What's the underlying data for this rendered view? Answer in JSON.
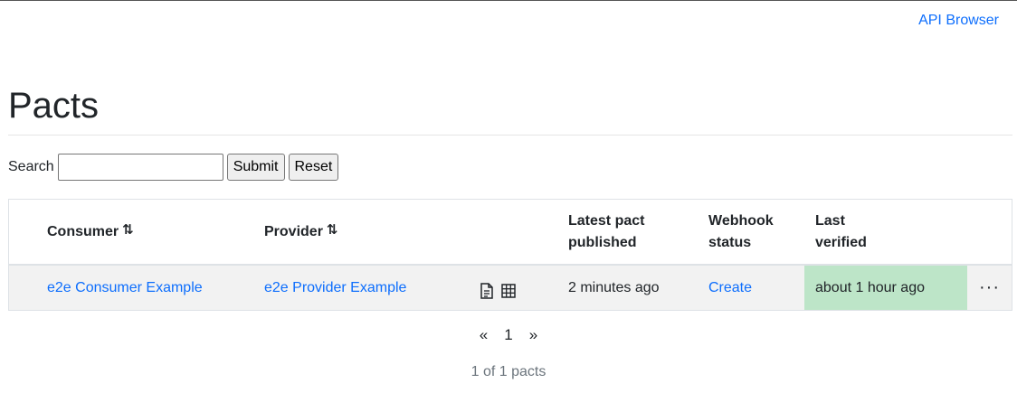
{
  "nav": {
    "api_browser": "API Browser"
  },
  "page": {
    "title": "Pacts"
  },
  "search": {
    "label": "Search",
    "value": "",
    "placeholder": "",
    "submit": "Submit",
    "reset": "Reset"
  },
  "table": {
    "headers": {
      "consumer": "Consumer",
      "provider": "Provider",
      "latest_pact_line1": "Latest pact",
      "latest_pact_line2": "published",
      "webhook_line1": "Webhook",
      "webhook_line2": "status",
      "verified_line1": "Last",
      "verified_line2": "verified"
    },
    "sort_glyph": "⇅",
    "rows": [
      {
        "consumer": "e2e Consumer Example",
        "provider": "e2e Provider Example",
        "icons": [
          "document-icon",
          "matrix-icon"
        ],
        "latest_published": "2 minutes ago",
        "webhook": "Create",
        "last_verified": "about 1 hour ago",
        "actions": "···"
      }
    ],
    "verified_color": "#bde5c8"
  },
  "pagination": {
    "prev": "«",
    "page": "1",
    "next": "»",
    "summary": "1 of 1 pacts"
  }
}
